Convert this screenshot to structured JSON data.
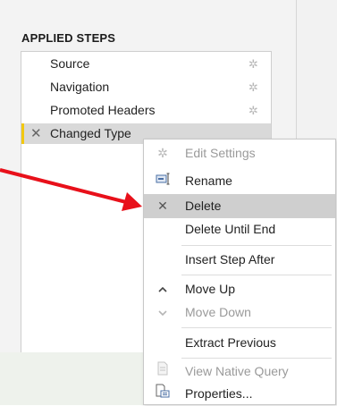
{
  "applied_steps": {
    "title": "APPLIED STEPS",
    "steps": [
      {
        "label": "Source",
        "has_settings": true
      },
      {
        "label": "Navigation",
        "has_settings": true
      },
      {
        "label": "Promoted Headers",
        "has_settings": true
      },
      {
        "label": "Changed Type",
        "selected": true,
        "icon": "x-icon"
      }
    ]
  },
  "context_menu": {
    "items": [
      {
        "label": "Edit Settings",
        "icon": "gear-icon",
        "enabled": false
      },
      {
        "label": "Rename",
        "icon": "rename-icon",
        "enabled": true
      },
      {
        "label": "Delete",
        "icon": "x-icon",
        "enabled": true,
        "highlighted": true
      },
      {
        "label": "Delete Until End",
        "icon": "",
        "enabled": true
      },
      {
        "label": "Insert Step After",
        "icon": "",
        "enabled": true
      },
      {
        "label": "Move Up",
        "icon": "chevron-up-icon",
        "enabled": true
      },
      {
        "label": "Move Down",
        "icon": "chevron-down-icon",
        "enabled": false
      },
      {
        "label": "Extract Previous",
        "icon": "",
        "enabled": true
      },
      {
        "label": "View Native Query",
        "icon": "native-query-icon",
        "enabled": false
      },
      {
        "label": "Properties...",
        "icon": "properties-icon",
        "enabled": true
      }
    ]
  },
  "colors": {
    "arrow": "#e8101a",
    "selected_marker": "#f2c811",
    "menu_highlight": "#cfcfcf"
  }
}
